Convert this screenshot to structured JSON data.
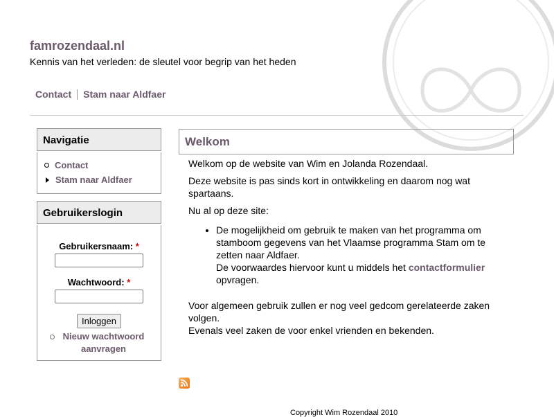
{
  "site": {
    "name": "famrozendaal.nl",
    "slogan": "Kennis van het verleden: de sleutel voor begrip van het heden"
  },
  "primary_links": [
    "Contact",
    "Stam naar Aldfaer"
  ],
  "navigation": {
    "title": "Navigatie",
    "items": [
      {
        "label": "Contact",
        "icon": "circle-bullet-icon"
      },
      {
        "label": "Stam naar Aldfaer",
        "icon": "triangle-bullet-icon"
      }
    ]
  },
  "login": {
    "title": "Gebruikerslogin",
    "username_label": "Gebruikersnaam:",
    "password_label": "Wachtwoord:",
    "required_marker": "*",
    "username_value": "",
    "password_value": "",
    "submit_label": "Inloggen",
    "new_password_link": "Nieuw wachtwoord aanvragen"
  },
  "content": {
    "title": "Welkom",
    "p1": "Welkom op de website van Wim en Jolanda Rozendaal.",
    "p2": "Deze website is pas sinds kort in ontwikkeling en daarom nog wat spartaans.",
    "p3": "Nu al op deze site:",
    "li1_text": "De mogelijkheid om gebruik te maken van het programma om stamboom gegevens van het Vlaamse programma Stam om te zetten naar Aldfaer.",
    "li1_line2_before": "De voorwaardes hiervoor kunt u middels het ",
    "li1_link": "contactformulier",
    "li1_line2_after": "opvragen.",
    "p4_line1": "Voor algemeen gebruik zullen er nog veel gedcom gerelateerde zaken volgen.",
    "p4_line2": "Evenals veel zaken de voor enkel vrienden en bekenden."
  },
  "footer": {
    "copyright": "Copyright Wim Rozendaal 2010"
  },
  "colors": {
    "accent": "#6b5a6b",
    "required": "#cc0000",
    "block_title_bg": "#ececec",
    "border": "#999999"
  },
  "icons": {
    "feed": "rss-feed-icon"
  }
}
